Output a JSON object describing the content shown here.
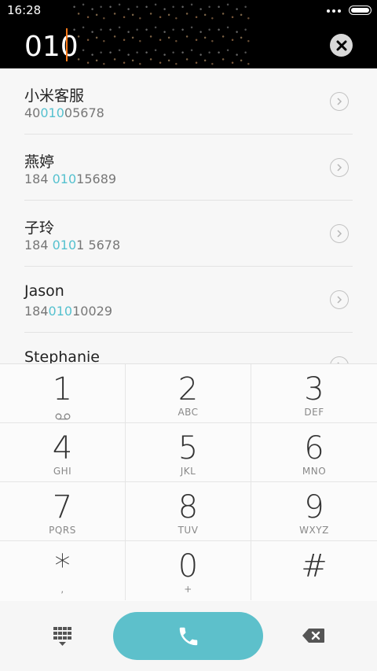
{
  "status_bar": {
    "time": "16:28"
  },
  "dialer": {
    "number": "010"
  },
  "contacts": [
    {
      "name": "小米客服",
      "phone_pre": "40",
      "phone_hl": "010",
      "phone_post": "05678"
    },
    {
      "name": "燕婷",
      "phone_pre": "184 ",
      "phone_hl": "010",
      "phone_post": "15689"
    },
    {
      "name": "子玲",
      "phone_pre": "184 ",
      "phone_hl": "010",
      "phone_post": "1 5678"
    },
    {
      "name": "Jason",
      "phone_pre": "184",
      "phone_hl": "010",
      "phone_post": "10029"
    },
    {
      "name": "Stephanie",
      "phone_pre": "",
      "phone_hl": "",
      "phone_post": ""
    }
  ],
  "keypad": [
    {
      "digit": "1",
      "letters": ""
    },
    {
      "digit": "2",
      "letters": "ABC"
    },
    {
      "digit": "3",
      "letters": "DEF"
    },
    {
      "digit": "4",
      "letters": "GHI"
    },
    {
      "digit": "5",
      "letters": "JKL"
    },
    {
      "digit": "6",
      "letters": "MNO"
    },
    {
      "digit": "7",
      "letters": "PQRS"
    },
    {
      "digit": "8",
      "letters": "TUV"
    },
    {
      "digit": "9",
      "letters": "WXYZ"
    },
    {
      "digit": "*",
      "letters": ","
    },
    {
      "digit": "0",
      "letters": "+"
    },
    {
      "digit": "#",
      "letters": ""
    }
  ],
  "icons": {
    "clear": "close-icon",
    "detail": "chevron-right-icon",
    "voicemail": "voicemail-icon",
    "dialpad": "dialpad-icon",
    "call": "phone-icon",
    "backspace": "backspace-icon"
  },
  "colors": {
    "accent": "#5dc0cb",
    "highlight": "#55c1cf",
    "cursor": "#ff7a1a"
  }
}
